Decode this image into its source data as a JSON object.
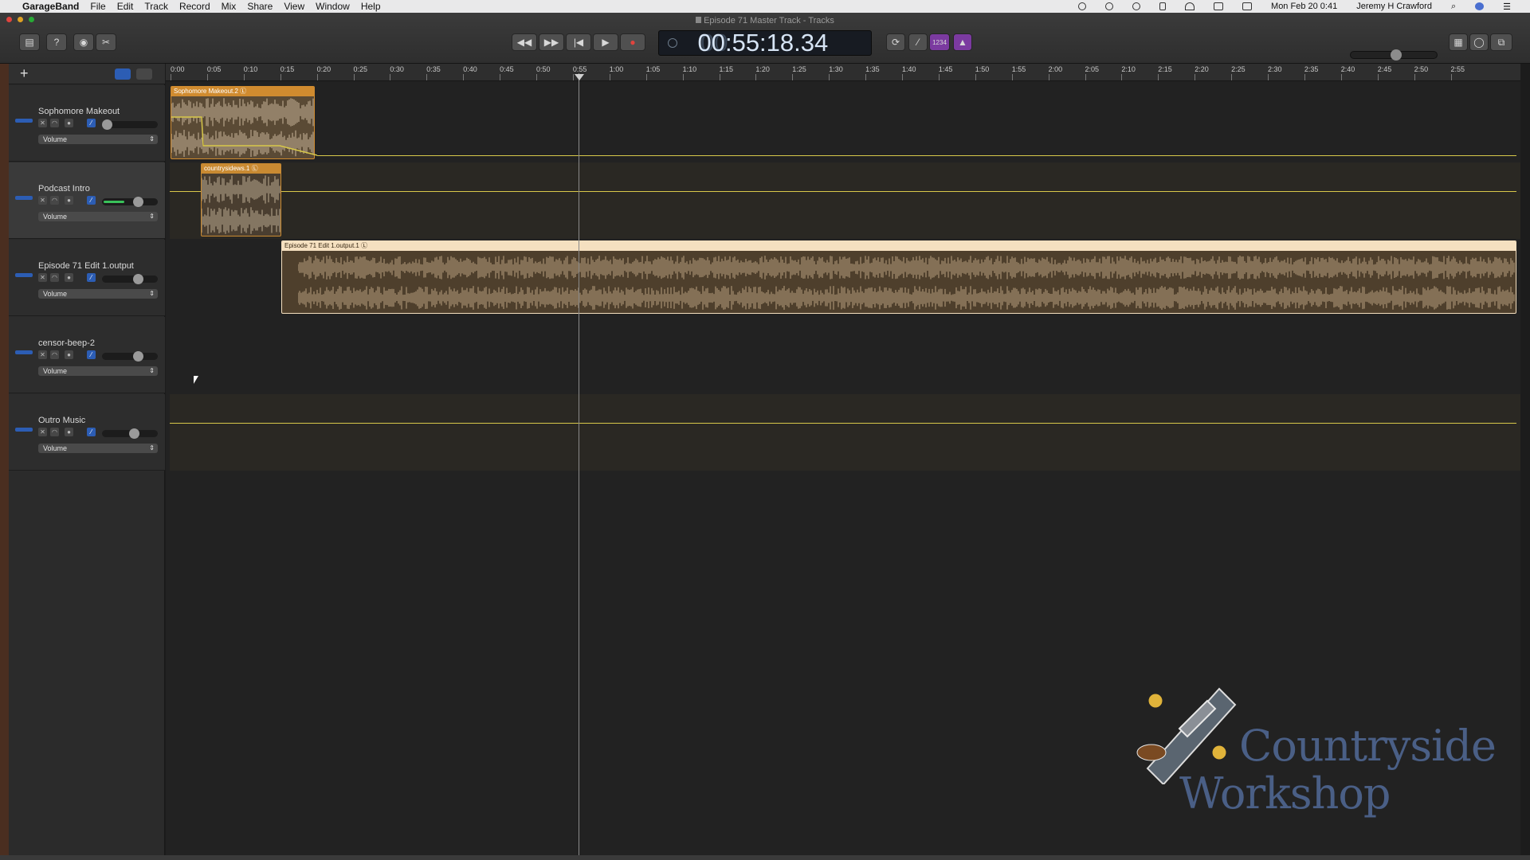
{
  "menubar": {
    "apple": "",
    "items": [
      "GarageBand",
      "File",
      "Edit",
      "Track",
      "Record",
      "Mix",
      "Share",
      "View",
      "Window",
      "Help"
    ],
    "clock": "Mon Feb 20  0:41",
    "user": "Jeremy H Crawford"
  },
  "window": {
    "title": "Episode 71 Master Track - Tracks"
  },
  "lcd": {
    "dim_prefix": "00",
    "time": "00:55:18.34"
  },
  "transport": {
    "rewind": "◀◀",
    "forward": "▶▶",
    "to_start": "|◀",
    "play": "▶",
    "record": "●"
  },
  "toolbar_right": {
    "count_in": "1234"
  },
  "tracks": [
    {
      "name": "Sophomore Makeout",
      "automation": "Volume",
      "fader": 0.0,
      "level": 0.0
    },
    {
      "name": "Podcast Intro",
      "automation": "Volume",
      "fader": 0.7,
      "level": 0.4
    },
    {
      "name": "Episode 71 Edit 1.output",
      "automation": "Volume",
      "fader": 0.7,
      "level": 0.0
    },
    {
      "name": "censor-beep-2",
      "automation": "Volume",
      "fader": 0.7,
      "level": 0.0
    },
    {
      "name": "Outro Music",
      "automation": "Volume",
      "fader": 0.6,
      "level": 0.0
    }
  ],
  "regions": [
    {
      "name": "Sophomore Makeout.2",
      "track": 0
    },
    {
      "name": "countrysidews.1",
      "track": 1
    },
    {
      "name": "Episode 71 Edit 1.output.1",
      "track": 2
    }
  ],
  "ruler": {
    "ticks": [
      "0:00",
      "0:05",
      "0:10",
      "0:15",
      "0:20",
      "0:25",
      "0:30",
      "0:35",
      "0:40",
      "0:45",
      "0:50",
      "0:55",
      "1:00",
      "1:05",
      "1:10",
      "1:15",
      "1:20",
      "1:25",
      "1:30",
      "1:35",
      "1:40",
      "1:45",
      "1:50",
      "1:55",
      "2:00",
      "2:05",
      "2:10",
      "2:15",
      "2:20",
      "2:25",
      "2:30",
      "2:35",
      "2:40",
      "2:45",
      "2:50",
      "2:55"
    ]
  },
  "logo": {
    "line1": "Countryside",
    "line2": "Workshop"
  },
  "colors": {
    "region_orange": "#d68a2c",
    "region_selected": "#f5e0c0",
    "automation_line": "#d8c84a",
    "lcd_text": "#d6e4f4"
  }
}
